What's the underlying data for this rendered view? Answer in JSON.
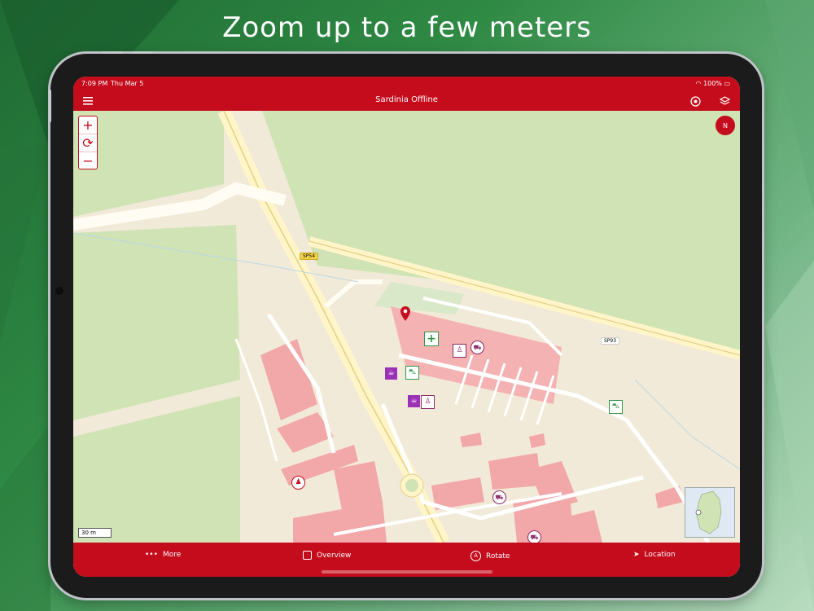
{
  "headline": "Zoom up to a few meters",
  "status": {
    "time": "7:09 PM",
    "date": "Thu Mar 5",
    "battery": "100%"
  },
  "nav": {
    "title": "Sardinia Offline",
    "menu_icon": "hamburger-icon",
    "gps_icon": "target-icon",
    "layers_icon": "layers-icon"
  },
  "map": {
    "zoom_in": "+",
    "zoom_out": "−",
    "compass": "N",
    "scale": "30 m",
    "road_labels": [
      "SP54",
      "SP93"
    ]
  },
  "tabs": [
    {
      "label": "More",
      "icon": "ellipsis-icon"
    },
    {
      "label": "Overview",
      "icon": "square-icon"
    },
    {
      "label": "Rotate",
      "icon": "compass-a-icon"
    },
    {
      "label": "Location",
      "icon": "arrow-location-icon"
    }
  ],
  "colors": {
    "brand": "#c50c1d",
    "map_bg": "#f2ead8",
    "park": "#cfe3b5",
    "building": "#f2a7a9",
    "road": "#fff5c9"
  }
}
